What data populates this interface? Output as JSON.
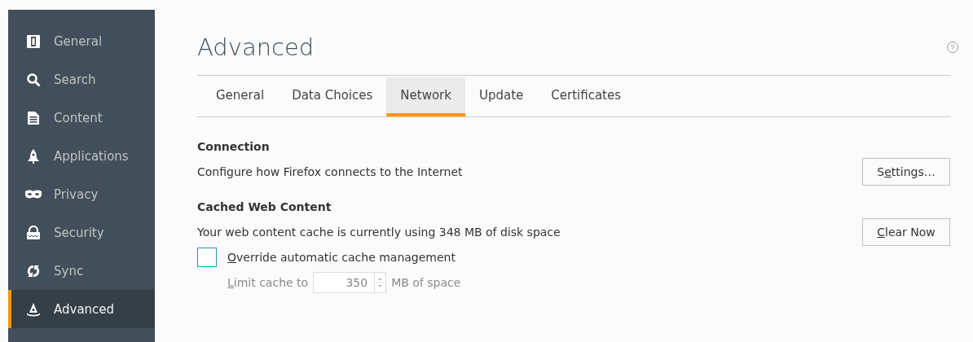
{
  "sidebar": {
    "items": [
      {
        "label": "General",
        "selected": false
      },
      {
        "label": "Search",
        "selected": false
      },
      {
        "label": "Content",
        "selected": false
      },
      {
        "label": "Applications",
        "selected": false
      },
      {
        "label": "Privacy",
        "selected": false
      },
      {
        "label": "Security",
        "selected": false
      },
      {
        "label": "Sync",
        "selected": false
      },
      {
        "label": "Advanced",
        "selected": true
      }
    ]
  },
  "page": {
    "title": "Advanced",
    "help": "?"
  },
  "tabs": [
    {
      "label": "General",
      "selected": false
    },
    {
      "label": "Data Choices",
      "selected": false
    },
    {
      "label": "Network",
      "selected": true
    },
    {
      "label": "Update",
      "selected": false
    },
    {
      "label": "Certificates",
      "selected": false
    }
  ],
  "connection": {
    "heading": "Connection",
    "description": "Configure how Firefox connects to the Internet",
    "button": {
      "before": "S",
      "key": "e",
      "after": "ttings…"
    }
  },
  "cache": {
    "heading": "Cached Web Content",
    "description": "Your web content cache is currently using 348 MB of disk space",
    "button": {
      "key": "C",
      "after": "lear Now"
    },
    "override": {
      "checked": false,
      "label": {
        "key": "O",
        "after": "verride automatic cache management"
      }
    },
    "limit": {
      "disabled": true,
      "label": {
        "key": "L",
        "after": "imit cache to"
      },
      "value": "350",
      "unit": "MB of space"
    }
  }
}
